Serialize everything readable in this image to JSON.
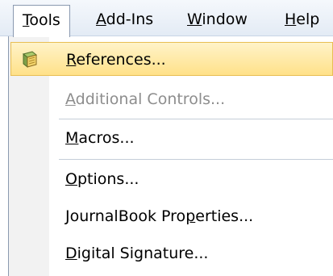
{
  "menubar": {
    "items": [
      {
        "label_acc": "T",
        "label_rest": "ools"
      },
      {
        "label_acc": "A",
        "label_rest": "dd-Ins"
      },
      {
        "label_acc": "W",
        "label_rest": "indow"
      },
      {
        "label_acc": "H",
        "label_rest": "elp"
      }
    ]
  },
  "dropdown": {
    "references": {
      "acc": "R",
      "rest": "eferences...",
      "icon": "references-book-icon"
    },
    "additional_controls": {
      "acc": "A",
      "rest": "dditional Controls..."
    },
    "macros": {
      "acc": "M",
      "rest": "acros..."
    },
    "options": {
      "acc": "O",
      "rest": "ptions..."
    },
    "journalbook": {
      "pre": "JournalBook Pro",
      "acc": "p",
      "rest": "erties..."
    },
    "digital_signature": {
      "acc": "D",
      "rest": "igital Signature..."
    }
  },
  "colors": {
    "highlight": "#ffe189",
    "highlight_border": "#e8be53",
    "disabled_text": "#8d8d8d"
  }
}
